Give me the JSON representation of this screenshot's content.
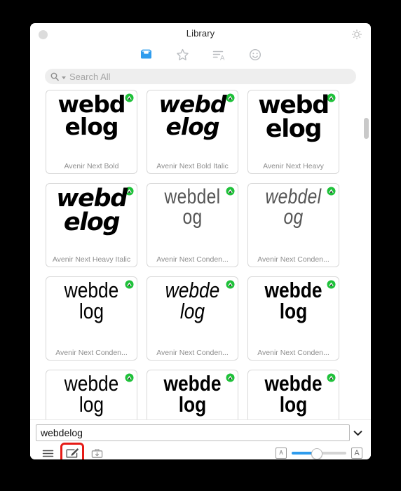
{
  "window": {
    "title": "Library",
    "close_button": "close-dot",
    "gear_label": "gear-icon"
  },
  "tabs": [
    {
      "name": "tab-library",
      "icon": "inbox-tray-icon",
      "active": true
    },
    {
      "name": "tab-favorites",
      "icon": "star-icon",
      "active": false
    },
    {
      "name": "tab-text",
      "icon": "text-lines-a-icon",
      "active": false
    },
    {
      "name": "tab-emoji",
      "icon": "smiley-face-icon",
      "active": false
    }
  ],
  "search": {
    "placeholder": "Search All",
    "value": "",
    "icon": "search-icon",
    "scope_caret": "caret-down-icon"
  },
  "grid": {
    "sample_text": "webdelog",
    "sample_line1": "webd",
    "sample_line2": "elog",
    "badge": "green-download-badge",
    "cards": [
      {
        "name": "Avenir Next Bold",
        "style": "s-bold",
        "line1": "webd",
        "line2": "elog"
      },
      {
        "name": "Avenir Next Bold Italic",
        "style": "s-bolditalic",
        "line1": "webd",
        "line2": "elog"
      },
      {
        "name": "Avenir Next Heavy",
        "style": "s-heavy",
        "line1": "webd",
        "line2": "elog"
      },
      {
        "name": "Avenir Next Heavy Italic",
        "style": "s-heavyitalic",
        "line1": "webd",
        "line2": "elog"
      },
      {
        "name": "Avenir Next Conden...",
        "style": "s-ultralight",
        "line1": "webdel",
        "line2": "og"
      },
      {
        "name": "Avenir Next Conden...",
        "style": "s-ultralighti",
        "line1": "webdel",
        "line2": "og"
      },
      {
        "name": "Avenir Next Conden...",
        "style": "s-light",
        "line1": "webde",
        "line2": "log"
      },
      {
        "name": "Avenir Next Conden...",
        "style": "s-lightitalic",
        "line1": "webde",
        "line2": "log"
      },
      {
        "name": "Avenir Next Conden...",
        "style": "s-medium",
        "line1": "webde",
        "line2": "log"
      },
      {
        "name": "",
        "style": "s-light",
        "line1": "webde",
        "line2": "log"
      },
      {
        "name": "",
        "style": "s-medium",
        "line1": "webde",
        "line2": "log"
      },
      {
        "name": "",
        "style": "s-medium",
        "line1": "webde",
        "line2": "log"
      }
    ]
  },
  "bottom": {
    "preview_value": "webdelog",
    "preview_chevron": "chevron-down-icon",
    "list_icon": "list-lines-icon",
    "compose_icon": "compose-pencil-icon",
    "install_icon": "install-download-icon",
    "size_small_label": "A",
    "size_large_label": "A",
    "slider_percent": 45,
    "highlight_color": "#e61b16",
    "accent_color": "#2f9ced"
  }
}
